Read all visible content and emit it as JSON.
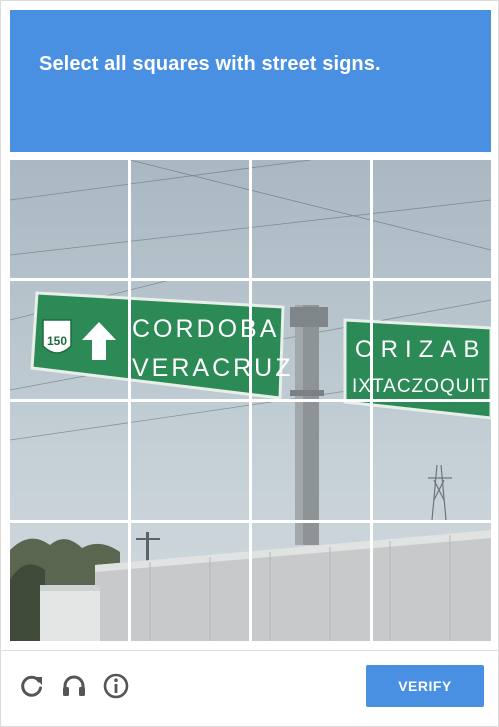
{
  "header": {
    "title": "Select all squares with street signs."
  },
  "scene": {
    "left_sign": {
      "route_shield": "150",
      "line1": "CORDOBA",
      "line2": "VERACRUZ"
    },
    "right_sign": {
      "line1": "ORIZAB",
      "line2": "IXTACZOQUITL"
    }
  },
  "grid": {
    "rows": 4,
    "columns": 4
  },
  "footer": {
    "reload_icon": "reload-icon",
    "audio_icon": "headphones-icon",
    "info_icon": "info-icon",
    "verify_label": "VERIFY"
  },
  "colors": {
    "accent": "#4a90e2",
    "sign_green": "#1f7a4a"
  }
}
